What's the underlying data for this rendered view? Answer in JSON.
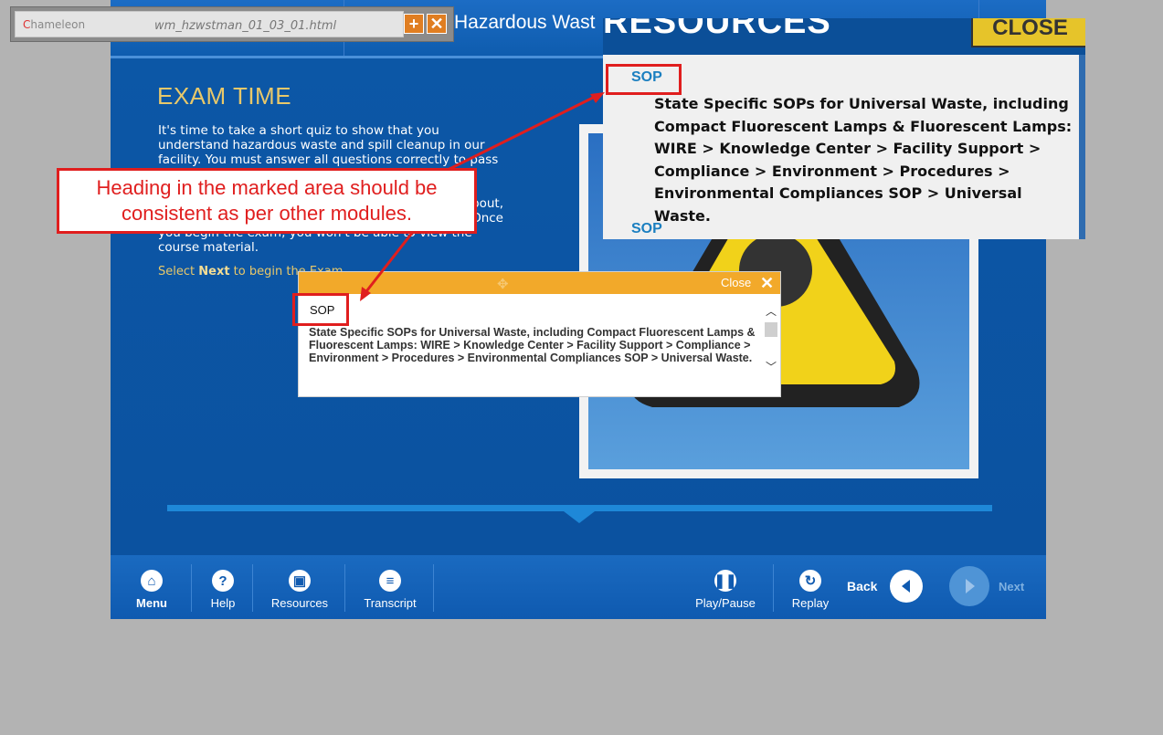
{
  "chameleon": {
    "logo": "hameleon",
    "filename": "wm_hzwstman_01_03_01.html",
    "add_icon": "plus-icon",
    "close_icon": "x-icon"
  },
  "course": {
    "title": "Hazardous Wast",
    "section_title": "EXAM TIME",
    "para1": "It's time to take a short quiz to show that you understand hazardous waste and spill cleanup in our facility.  You must answer all questions correctly to pass and complete this",
    "para2_line1": "bout,",
    "para2_line2": "Once",
    "para2_line3": "you begin the exam, you won't be able to view the course material.",
    "select_prefix": "Select ",
    "select_bold": "Next",
    "select_suffix": " to begin the Exam."
  },
  "resources_panel": {
    "title": "RESOURCES",
    "close_label": "CLOSE",
    "sop1_heading": "SOP",
    "sop1_text": "State Specific SOPs for Universal Waste, including Compact Fluorescent Lamps & Fluorescent Lamps:  WIRE > Knowledge Center > Facility Support > Compliance > Environment > Procedures > Environmental Compliances SOP > Universal Waste.",
    "sop2_heading": "SOP"
  },
  "popup": {
    "close_label": "Close",
    "heading": "SOP",
    "text": "State Specific SOPs for Universal Waste, including Compact Fluorescent Lamps & Fluorescent Lamps:  WIRE > Knowledge Center > Facility Support > Compliance > Environment > Procedures > Environmental Compliances SOP > Universal Waste."
  },
  "annotation": {
    "line1": "Heading in the marked area should be",
    "line2": "consistent as per other modules."
  },
  "footer": {
    "menu": "Menu",
    "help": "Help",
    "resources": "Resources",
    "transcript": "Transcript",
    "play_pause": "Play/Pause",
    "replay": "Replay",
    "back": "Back",
    "next": "Next"
  },
  "colors": {
    "course_blue": "#0a55a3",
    "accent_gold": "#e8c86a",
    "popup_orange": "#f2a92a",
    "annotation_red": "#e01e1e"
  }
}
